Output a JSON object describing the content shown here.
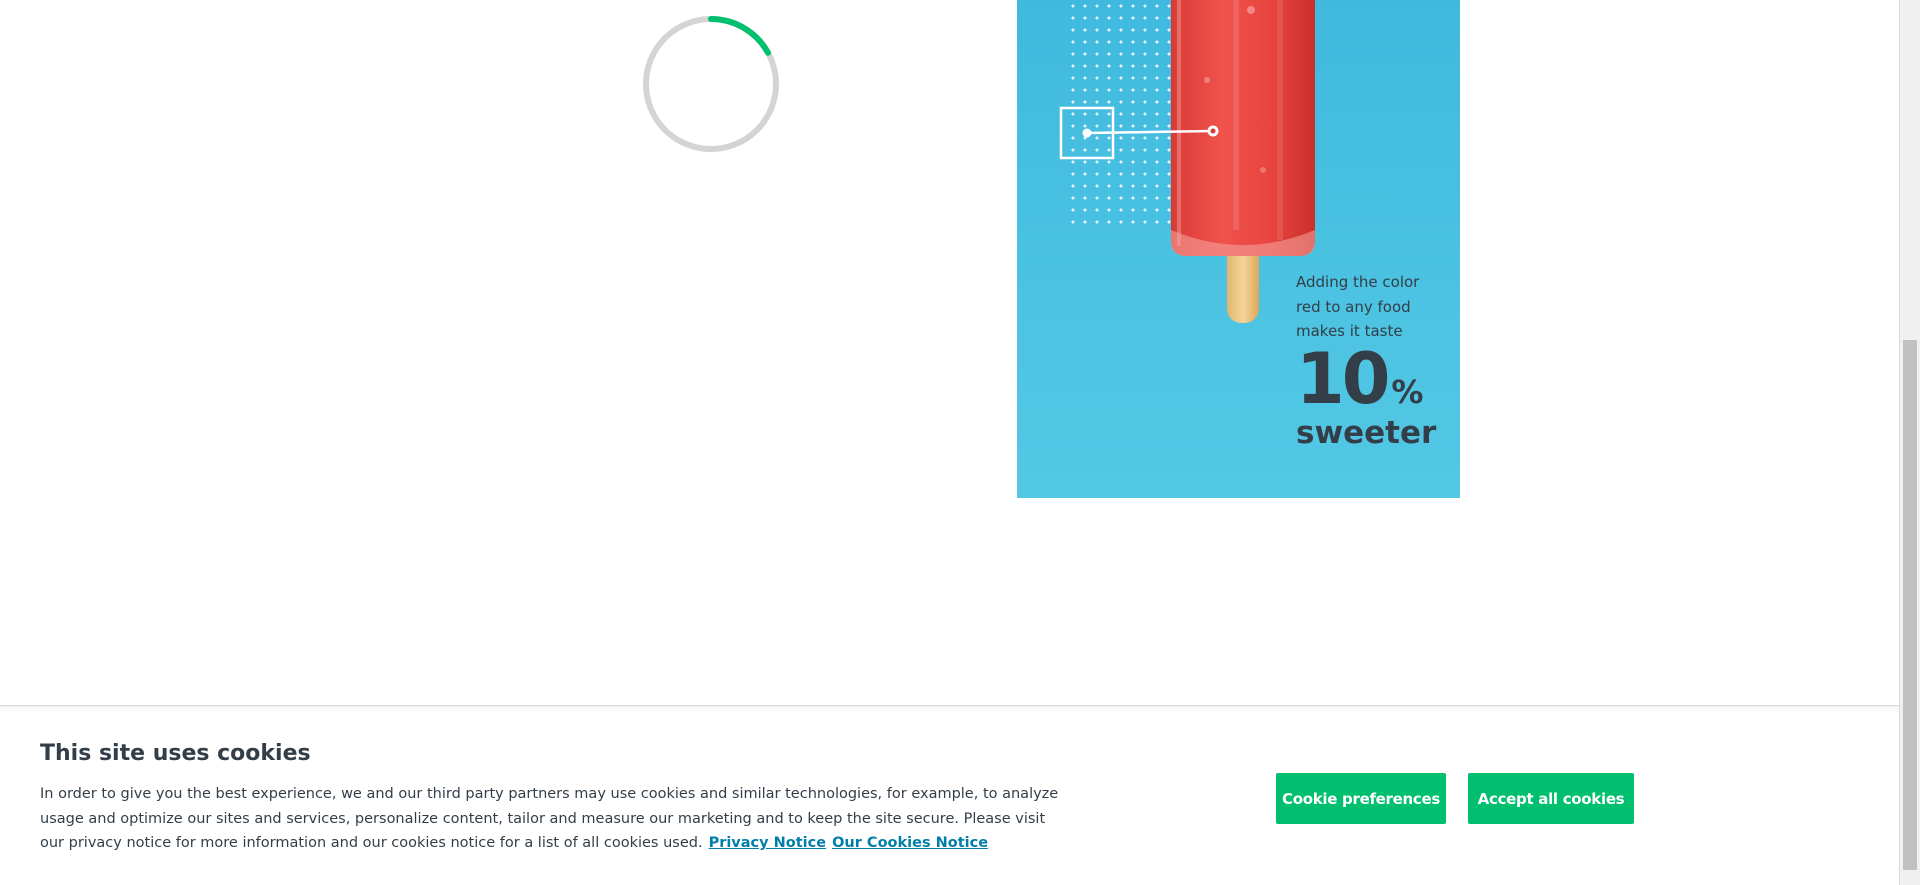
{
  "loader": {
    "progress_fraction": 0.17,
    "track_color": "#d4d4d4",
    "arc_color": "#00bf6f"
  },
  "promo": {
    "background_color": "#4cc3e2",
    "lead_line_1": "Adding the color",
    "lead_line_2": "red to any food",
    "lead_line_3": "makes it taste",
    "number": "10",
    "percent": "%",
    "word": "sweeter"
  },
  "cookie_banner": {
    "title": "This site uses cookies",
    "body": "In order to give you the best experience, we and our third party partners may use cookies and similar technologies, for example, to analyze usage and optimize our sites and services, personalize content, tailor and measure our marketing and to keep the site secure. Please visit our privacy notice for more information and our cookies notice for a list of all cookies used.",
    "privacy_link": "Privacy Notice",
    "cookies_link": "Our Cookies Notice",
    "preferences_button": "Cookie preferences",
    "accept_button": "Accept all cookies",
    "button_color": "#00bf6f",
    "link_color": "#007faa"
  }
}
